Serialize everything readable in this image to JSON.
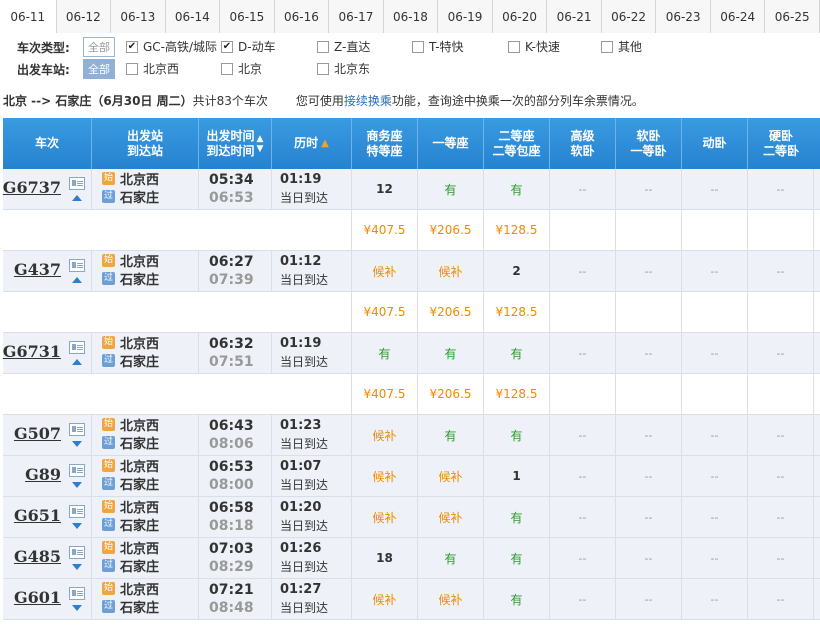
{
  "date_tabs": [
    "06-11",
    "06-12",
    "06-13",
    "06-14",
    "06-15",
    "06-16",
    "06-17",
    "06-18",
    "06-19",
    "06-20",
    "06-21",
    "06-22",
    "06-23",
    "06-24",
    "06-25"
  ],
  "filters": {
    "type_label": "车次类型:",
    "station_label": "出发车站:",
    "all_label": "全部",
    "types": [
      {
        "label": "GC-高铁/城际",
        "checked": true
      },
      {
        "label": "D-动车",
        "checked": true
      },
      {
        "label": "Z-直达",
        "checked": false
      },
      {
        "label": "T-特快",
        "checked": false
      },
      {
        "label": "K-快速",
        "checked": false
      },
      {
        "label": "其他",
        "checked": false
      }
    ],
    "stations": [
      {
        "label": "北京西",
        "checked": false
      },
      {
        "label": "北京",
        "checked": false
      },
      {
        "label": "北京东",
        "checked": false
      }
    ]
  },
  "summary": {
    "route": "北京 --> 石家庄（6月30日 周二）",
    "count_text": "共计83个车次",
    "hint_prefix": "您可使用",
    "hint_link": "接续换乘",
    "hint_suffix": "功能，查询途中换乘一次的部分列车余票情况。"
  },
  "headers": {
    "train": "车次",
    "station": [
      "出发站",
      "到达站"
    ],
    "time": [
      "出发时间",
      "到达时间"
    ],
    "duration": "历时",
    "seats": [
      [
        "商务座",
        "特等座"
      ],
      [
        "一等座"
      ],
      [
        "二等座",
        "二等包座"
      ],
      [
        "高级",
        "软卧"
      ],
      [
        "软卧",
        "一等卧"
      ],
      [
        "动卧"
      ],
      [
        "硬卧",
        "二等卧"
      ]
    ]
  },
  "badges": {
    "start": "始",
    "pass": "过"
  },
  "trains": [
    {
      "no": "G6737",
      "from": "北京西",
      "to": "石家庄",
      "dep": "05:34",
      "arr": "06:53",
      "dur": "01:19",
      "day": "当日到达",
      "expanded": true,
      "seats": [
        "12",
        "有",
        "有",
        "--",
        "--",
        "--",
        "--"
      ],
      "prices": [
        "¥407.5",
        "¥206.5",
        "¥128.5"
      ]
    },
    {
      "no": "G437",
      "from": "北京西",
      "to": "石家庄",
      "dep": "06:27",
      "arr": "07:39",
      "dur": "01:12",
      "day": "当日到达",
      "expanded": true,
      "seats": [
        "候补",
        "候补",
        "2",
        "--",
        "--",
        "--",
        "--"
      ],
      "prices": [
        "¥407.5",
        "¥206.5",
        "¥128.5"
      ]
    },
    {
      "no": "G6731",
      "from": "北京西",
      "to": "石家庄",
      "dep": "06:32",
      "arr": "07:51",
      "dur": "01:19",
      "day": "当日到达",
      "expanded": true,
      "seats": [
        "有",
        "有",
        "有",
        "--",
        "--",
        "--",
        "--"
      ],
      "prices": [
        "¥407.5",
        "¥206.5",
        "¥128.5"
      ]
    },
    {
      "no": "G507",
      "from": "北京西",
      "to": "石家庄",
      "dep": "06:43",
      "arr": "08:06",
      "dur": "01:23",
      "day": "当日到达",
      "expanded": false,
      "seats": [
        "候补",
        "有",
        "有",
        "--",
        "--",
        "--",
        "--"
      ]
    },
    {
      "no": "G89",
      "from": "北京西",
      "to": "石家庄",
      "dep": "06:53",
      "arr": "08:00",
      "dur": "01:07",
      "day": "当日到达",
      "expanded": false,
      "seats": [
        "候补",
        "候补",
        "1",
        "--",
        "--",
        "--",
        "--"
      ]
    },
    {
      "no": "G651",
      "from": "北京西",
      "to": "石家庄",
      "dep": "06:58",
      "arr": "08:18",
      "dur": "01:20",
      "day": "当日到达",
      "expanded": false,
      "seats": [
        "候补",
        "候补",
        "有",
        "--",
        "--",
        "--",
        "--"
      ]
    },
    {
      "no": "G485",
      "from": "北京西",
      "to": "石家庄",
      "dep": "07:03",
      "arr": "08:29",
      "dur": "01:26",
      "day": "当日到达",
      "expanded": false,
      "seats": [
        "18",
        "有",
        "有",
        "--",
        "--",
        "--",
        "--"
      ]
    },
    {
      "no": "G601",
      "from": "北京西",
      "to": "石家庄",
      "dep": "07:21",
      "arr": "08:48",
      "dur": "01:27",
      "day": "当日到达",
      "expanded": false,
      "seats": [
        "候补",
        "候补",
        "有",
        "--",
        "--",
        "--",
        "--"
      ]
    }
  ]
}
